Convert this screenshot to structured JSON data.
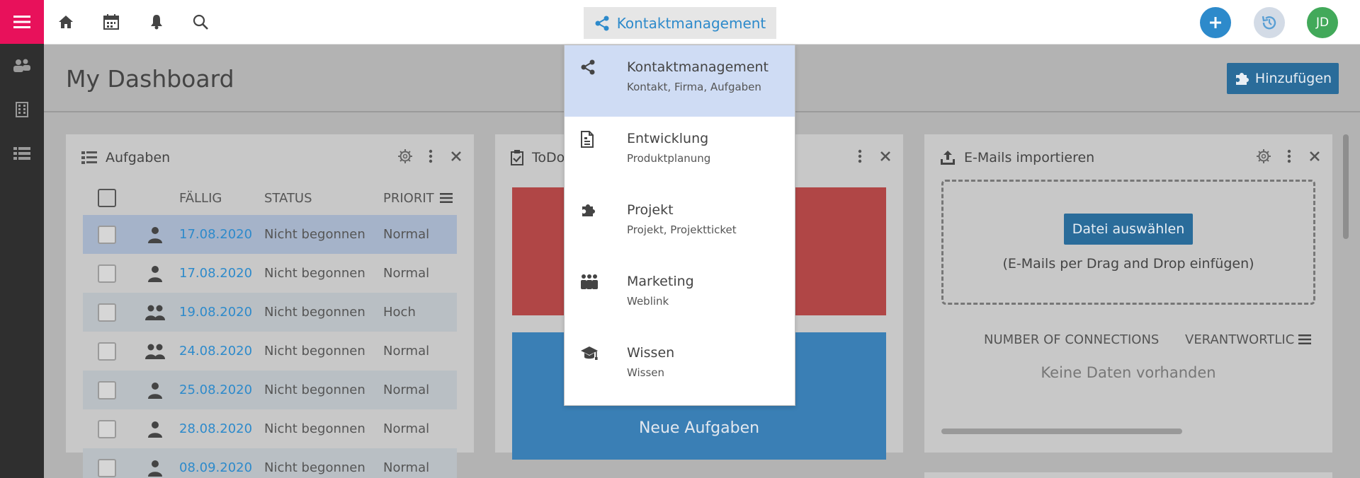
{
  "colors": {
    "accent": "#2d8acb",
    "menu_button": "#e8115b",
    "rail": "#2f2f2f",
    "user_avatar": "#42a95a",
    "tile_red": "#b04646",
    "tile_blue": "#3a7fb5",
    "selected_row": "#a5b3c9"
  },
  "rail": {
    "menu_icon": "hamburger-icon",
    "items": [
      "contacts-icon",
      "building-icon",
      "list-icon"
    ]
  },
  "topbar": {
    "icons": [
      "home-icon",
      "calendar-icon",
      "bell-icon",
      "search-icon"
    ],
    "module_button_label": "Kontaktmanagement",
    "user_initials": "JD"
  },
  "page": {
    "title": "My Dashboard",
    "add_widget_label": "Hinzufügen"
  },
  "tasks_widget": {
    "title": "Aufgaben",
    "columns": [
      "FÄLLIG",
      "STATUS",
      "PRIORIT"
    ],
    "rows": [
      {
        "icon": "single-person-icon",
        "date": "17.08.2020",
        "status": "Nicht begonnen",
        "priority": "Normal"
      },
      {
        "icon": "single-person-icon",
        "date": "17.08.2020",
        "status": "Nicht begonnen",
        "priority": "Normal"
      },
      {
        "icon": "group-persons-icon",
        "date": "19.08.2020",
        "status": "Nicht begonnen",
        "priority": "Hoch"
      },
      {
        "icon": "group-persons-icon",
        "date": "24.08.2020",
        "status": "Nicht begonnen",
        "priority": "Normal"
      },
      {
        "icon": "single-person-icon",
        "date": "25.08.2020",
        "status": "Nicht begonnen",
        "priority": "Normal"
      },
      {
        "icon": "single-person-icon",
        "date": "28.08.2020",
        "status": "Nicht begonnen",
        "priority": "Normal"
      },
      {
        "icon": "single-person-icon",
        "date": "08.09.2020",
        "status": "Nicht begonnen",
        "priority": "Normal"
      }
    ]
  },
  "todo_widget": {
    "title": "ToDo",
    "blue_tile_label": "Neue Aufgaben"
  },
  "email_widget": {
    "title": "E-Mails importieren",
    "file_button_label": "Datei auswählen",
    "dropzone_hint": "(E-Mails per Drag and Drop einfügen)",
    "columns": [
      "NUMBER OF CONNECTIONS",
      "VERANTWORTLIC"
    ],
    "empty_text": "Keine Daten vorhanden"
  },
  "module_dropdown": {
    "items": [
      {
        "label": "Kontaktmanagement",
        "sub": "Kontakt, Firma, Aufgaben",
        "icon": "share-icon",
        "active": true
      },
      {
        "label": "Entwicklung",
        "sub": "Produktplanung",
        "icon": "document-icon",
        "active": false
      },
      {
        "label": "Projekt",
        "sub": "Projekt, Projektticket",
        "icon": "puzzle-icon",
        "active": false
      },
      {
        "label": "Marketing",
        "sub": "Weblink",
        "icon": "people-icon",
        "active": false
      },
      {
        "label": "Wissen",
        "sub": "Wissen",
        "icon": "graduation-cap-icon",
        "active": false
      }
    ]
  }
}
